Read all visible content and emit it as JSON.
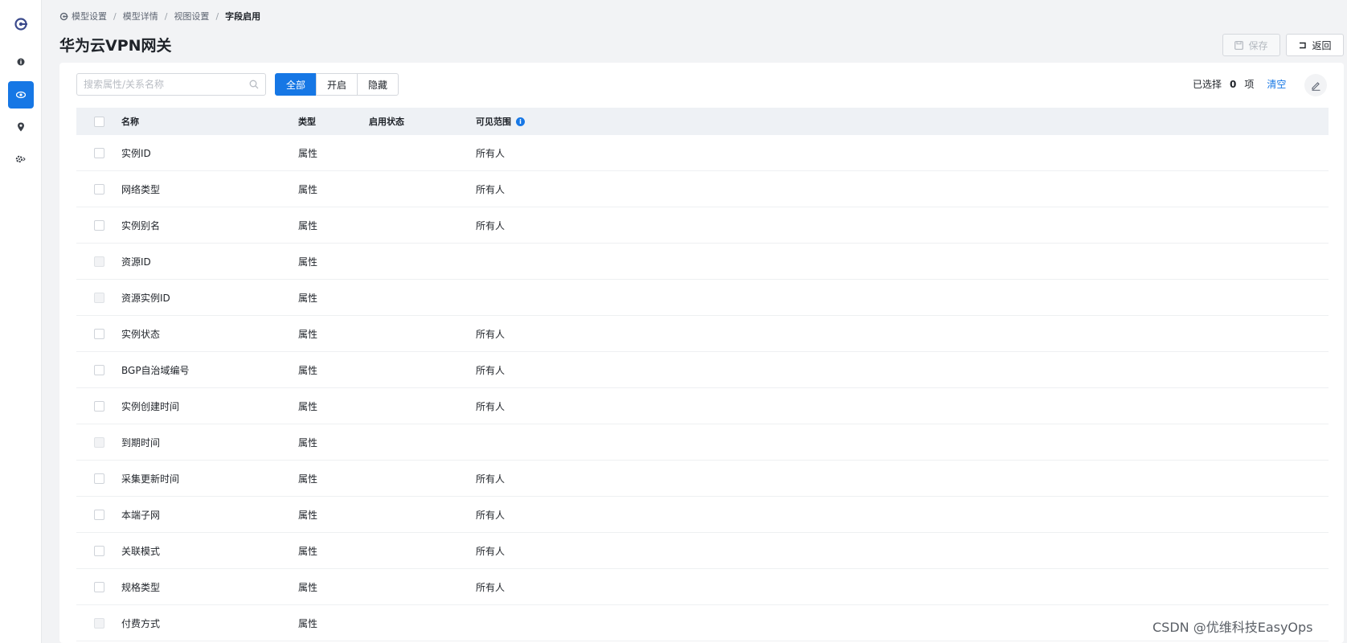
{
  "breadcrumb": {
    "items": [
      "模型设置",
      "模型详情",
      "视图设置"
    ],
    "separator": "/",
    "current": "字段启用"
  },
  "page": {
    "title": "华为云VPN网关"
  },
  "toolbar": {
    "save_label": "保存",
    "back_label": "返回"
  },
  "search": {
    "placeholder": "搜索属性/关系名称"
  },
  "filter": {
    "tabs": [
      "全部",
      "开启",
      "隐藏"
    ],
    "active": "全部"
  },
  "selection": {
    "prefix": "已选择",
    "count": "0",
    "suffix": "项",
    "clear_label": "清空"
  },
  "table": {
    "headers": {
      "name": "名称",
      "type": "类型",
      "status": "启用状态",
      "visibility": "可见范围"
    },
    "rows": [
      {
        "name": "实例ID",
        "type": "属性",
        "enabled": true,
        "visibility": "所有人"
      },
      {
        "name": "网络类型",
        "type": "属性",
        "enabled": true,
        "visibility": "所有人"
      },
      {
        "name": "实例别名",
        "type": "属性",
        "enabled": true,
        "visibility": "所有人"
      },
      {
        "name": "资源ID",
        "type": "属性",
        "enabled": false,
        "visibility": ""
      },
      {
        "name": "资源实例ID",
        "type": "属性",
        "enabled": false,
        "visibility": ""
      },
      {
        "name": "实例状态",
        "type": "属性",
        "enabled": true,
        "visibility": "所有人"
      },
      {
        "name": "BGP自治域编号",
        "type": "属性",
        "enabled": true,
        "visibility": "所有人"
      },
      {
        "name": "实例创建时间",
        "type": "属性",
        "enabled": true,
        "visibility": "所有人"
      },
      {
        "name": "到期时间",
        "type": "属性",
        "enabled": false,
        "visibility": ""
      },
      {
        "name": "采集更新时间",
        "type": "属性",
        "enabled": true,
        "visibility": "所有人"
      },
      {
        "name": "本端子网",
        "type": "属性",
        "enabled": true,
        "visibility": "所有人"
      },
      {
        "name": "关联模式",
        "type": "属性",
        "enabled": true,
        "visibility": "所有人"
      },
      {
        "name": "规格类型",
        "type": "属性",
        "enabled": true,
        "visibility": "所有人"
      },
      {
        "name": "付费方式",
        "type": "属性",
        "enabled": false,
        "visibility": ""
      }
    ]
  },
  "watermark": "CSDN @优维科技EasyOps",
  "colors": {
    "accent": "#1677e5",
    "toggle_off": "#c9ccd1",
    "header_bg": "#eef1f5"
  },
  "icons": {
    "rail": [
      "logo-icon",
      "info-icon",
      "eye-icon",
      "location-pin-icon",
      "gear-icon"
    ],
    "search": "search-icon",
    "save": "save-icon",
    "back": "back-arrow-icon",
    "edit": "pencil-icon"
  }
}
